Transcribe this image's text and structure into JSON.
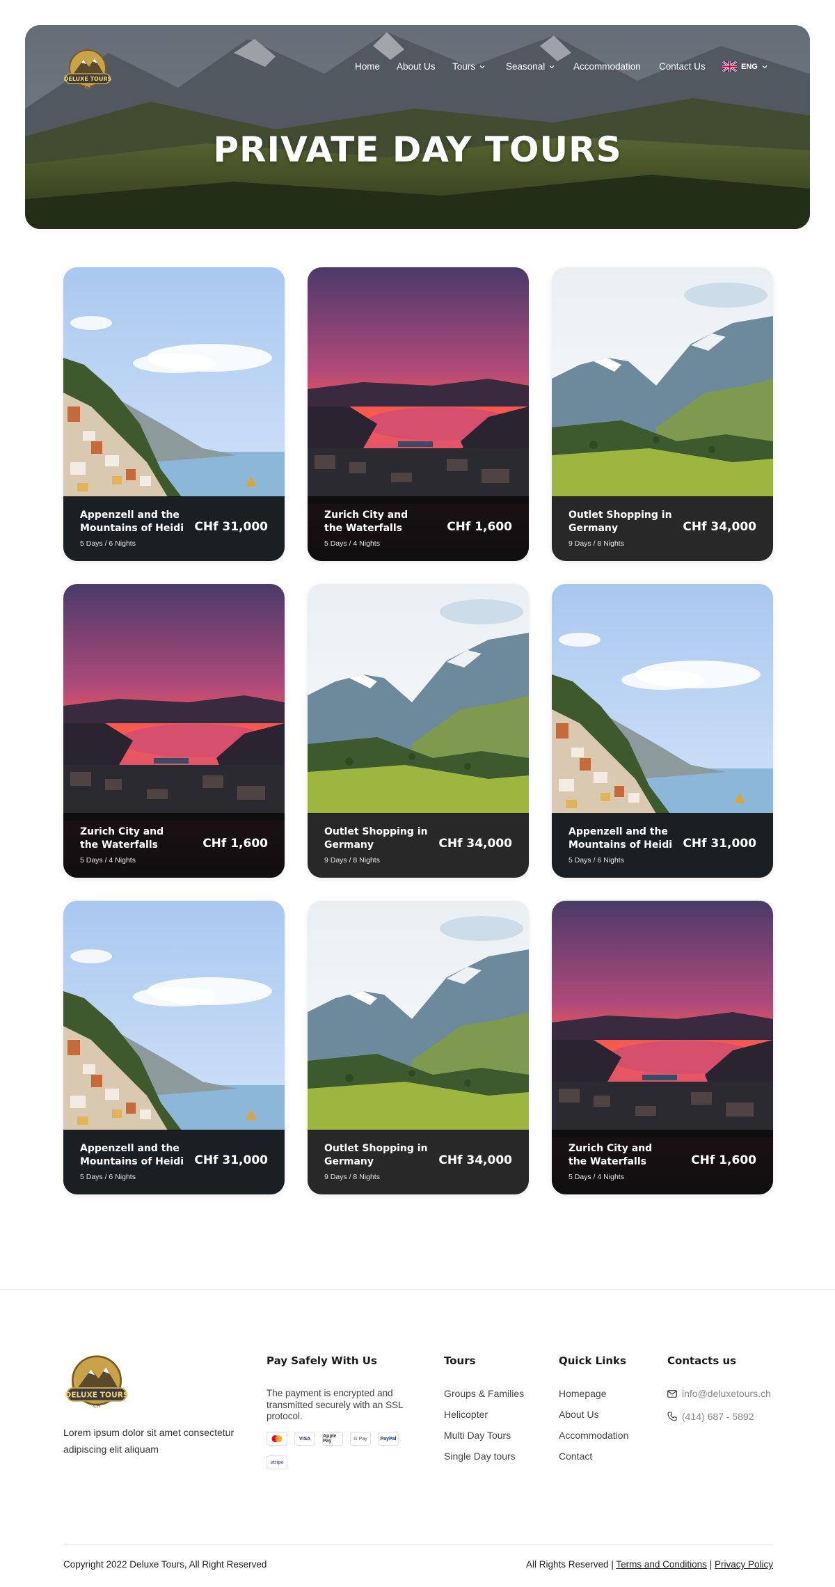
{
  "brand": {
    "logo_text": "DELUXE TOURS",
    "logo_sub": "CH"
  },
  "nav": {
    "home": "Home",
    "about": "About Us",
    "tours": "Tours",
    "seasonal": "Seasonal",
    "accommodation": "Accommodation",
    "contact": "Contact Us",
    "language": "ENG"
  },
  "hero": {
    "title": "PRIVATE DAY TOURS"
  },
  "cards": [
    {
      "title": "Appenzell and the Mountains of Heidi",
      "duration": "5 Days / 6 Nights",
      "price": "CHf 31,000",
      "image": "coastal-village"
    },
    {
      "title": "Zurich City and the Waterfalls",
      "duration": "5 Days / 4 Nights",
      "price": "CHf 1,600",
      "image": "sunset-lake-city"
    },
    {
      "title": "Outlet Shopping in Germany",
      "duration": "9 Days / 8 Nights",
      "price": "CHf 34,000",
      "image": "alpine-valley"
    },
    {
      "title": "Zurich City and the Waterfalls",
      "duration": "5 Days / 4 Nights",
      "price": "CHf 1,600",
      "image": "sunset-lake-city"
    },
    {
      "title": "Outlet Shopping in Germany",
      "duration": "9 Days / 8 Nights",
      "price": "CHf 34,000",
      "image": "alpine-valley"
    },
    {
      "title": "Appenzell and the Mountains of Heidi",
      "duration": "5 Days / 6 Nights",
      "price": "CHf 31,000",
      "image": "coastal-village"
    },
    {
      "title": "Appenzell and the Mountains of Heidi",
      "duration": "5 Days / 6 Nights",
      "price": "CHf 31,000",
      "image": "coastal-village"
    },
    {
      "title": "Outlet Shopping in Germany",
      "duration": "9 Days / 8 Nights",
      "price": "CHf 34,000",
      "image": "alpine-valley"
    },
    {
      "title": "Zurich City and the Waterfalls",
      "duration": "5 Days / 4 Nights",
      "price": "CHf 1,600",
      "image": "sunset-lake-city"
    }
  ],
  "footer": {
    "description": "Lorem ipsum dolor sit amet consectetur adipiscing elit aliquam",
    "pay": {
      "heading": "Pay Safely With Us",
      "text": "The payment is encrypted and transmitted securely with an SSL protocol.",
      "methods": [
        "Mastercard",
        "VISA",
        "Apple Pay",
        "G Pay",
        "PayPal",
        "stripe"
      ]
    },
    "tours": {
      "heading": "Tours",
      "links": [
        "Groups & Families",
        "Helicopter",
        "Multi Day Tours",
        "Single Day tours"
      ]
    },
    "quick": {
      "heading": "Quick Links",
      "links": [
        "Homepage",
        "About Us",
        "Accommodation",
        "Contact"
      ]
    },
    "contacts": {
      "heading": "Contacts us",
      "email": "info@deluxetours.ch",
      "phone": "(414) 687 - 5892"
    },
    "copyright": "Copyright 2022 Deluxe Tours, All Right Reserved",
    "rights_prefix": "All Rights Reserved |",
    "terms": "Terms and Conditions",
    "separator": "|",
    "privacy": "Privacy Policy"
  },
  "colors": {
    "card_overlay": "#0a0a0a",
    "text_dark": "#1a1a1a",
    "text_muted": "#888888"
  }
}
